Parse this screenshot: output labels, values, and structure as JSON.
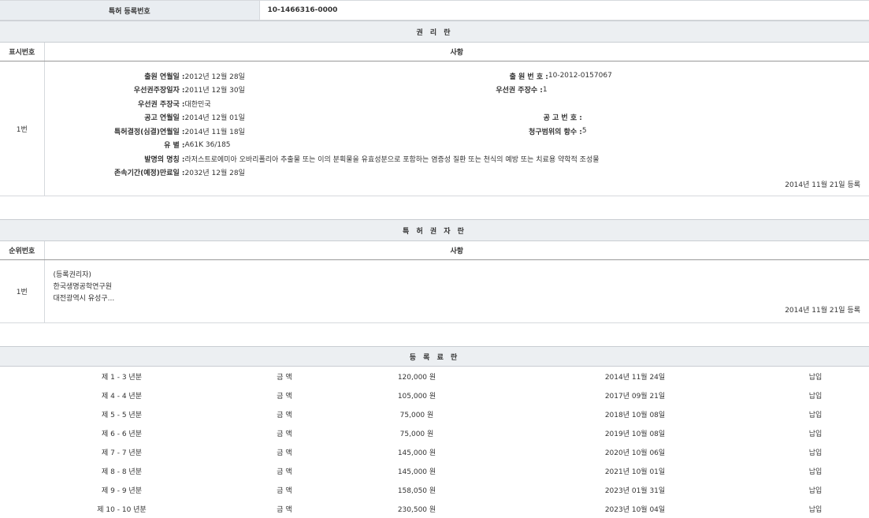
{
  "header": {
    "label": "특허 등록번호",
    "value": "10-1466316-0000"
  },
  "rights_section": {
    "title": "권 리 란",
    "col_num": "표시번호",
    "col_item": "사항",
    "entry_num": "1번",
    "left": [
      {
        "k": "출원 연월일 :",
        "v": "2012년 12월 28일"
      },
      {
        "k": "우선권주장일자 :",
        "v": "2011년 12월 30일"
      },
      {
        "k": "우선권 주장국 :",
        "v": "대한민국"
      },
      {
        "k": "공고 연월일 :",
        "v": "2014년 12월 01일"
      },
      {
        "k": "특허결정(심결)연월일 :",
        "v": "2014년 11월 18일"
      },
      {
        "k": "유 별 :",
        "v": "A61K 36/185"
      },
      {
        "k": "발명의 명칭 :",
        "v": "라저스트로에미아 오바리폴리아 추출물 또는 이의 분획물을 유효성분으로 포함하는 염증성 질환 또는 천식의 예방 또는 치료용 약학적 조성물"
      },
      {
        "k": "존속기간(예정)만료일 :",
        "v": "2032년 12월 28일"
      }
    ],
    "right": [
      {
        "k": "출 원 번 호 :",
        "v": "10-2012-0157067"
      },
      {
        "k": "우선권 주장수 :",
        "v": "1"
      },
      {
        "k": "공 고 번 호 :",
        "v": ""
      },
      {
        "k": "청구범위의 항수 :",
        "v": "5"
      }
    ],
    "reg_date": "2014년 11월 21일 등록"
  },
  "holder_section": {
    "title": "특 허 권 자 란",
    "col_num": "순위번호",
    "col_item": "사항",
    "entry_num": "1번",
    "type": "(등록권리자)",
    "name": "한국생명공학연구원",
    "address": "대전광역시 유성구...",
    "reg_date": "2014년 11월 21일 등록"
  },
  "fee_section": {
    "title": "등 록 료 란",
    "rows": [
      {
        "period": "제 1 - 3 년분",
        "label": "금 액",
        "amount": "120,000 원",
        "date": "2014년 11월 24일",
        "status": "납입"
      },
      {
        "period": "제 4 - 4 년분",
        "label": "금 액",
        "amount": "105,000 원",
        "date": "2017년 09월 21일",
        "status": "납입"
      },
      {
        "period": "제 5 - 5 년분",
        "label": "금 액",
        "amount": "75,000 원",
        "date": "2018년 10월 08일",
        "status": "납입"
      },
      {
        "period": "제 6 - 6 년분",
        "label": "금 액",
        "amount": "75,000 원",
        "date": "2019년 10월 08일",
        "status": "납입"
      },
      {
        "period": "제 7 - 7 년분",
        "label": "금 액",
        "amount": "145,000 원",
        "date": "2020년 10월 06일",
        "status": "납입"
      },
      {
        "period": "제 8 - 8 년분",
        "label": "금 액",
        "amount": "145,000 원",
        "date": "2021년 10월 01일",
        "status": "납입"
      },
      {
        "period": "제 9 - 9 년분",
        "label": "금 액",
        "amount": "158,050 원",
        "date": "2023년 01월 31일",
        "status": "납입"
      },
      {
        "period": "제 10 - 10 년분",
        "label": "금 액",
        "amount": "230,500 원",
        "date": "2023년 10월 04일",
        "status": "납입"
      }
    ]
  }
}
